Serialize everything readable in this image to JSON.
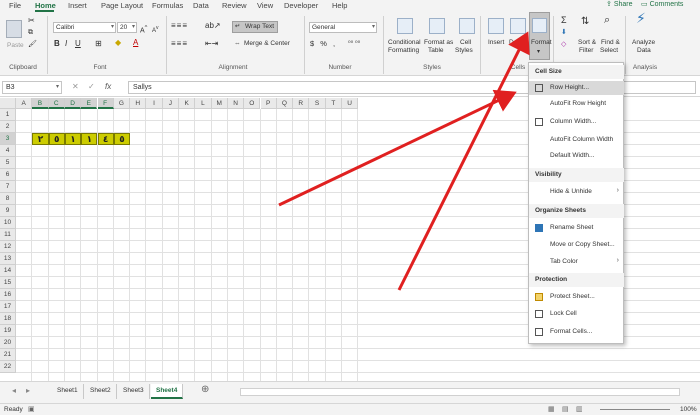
{
  "ribbon_tabs": [
    "File",
    "Home",
    "Insert",
    "Page Layout",
    "Formulas",
    "Data",
    "Review",
    "View",
    "Developer",
    "Help"
  ],
  "share_label": "Share",
  "comments_label": "Comments",
  "clipboard": {
    "paste": "Paste",
    "group": "Clipboard"
  },
  "font": {
    "name": "Calibri",
    "size": "20",
    "group": "Font"
  },
  "alignment": {
    "wrap": "Wrap Text",
    "merge": "Merge & Center",
    "group": "Alignment"
  },
  "number": {
    "format": "General",
    "group": "Number"
  },
  "styles": {
    "conditional": "Conditional",
    "formatting": "Formatting",
    "format_as": "Format as",
    "table": "Table",
    "cell": "Cell",
    "cell_styles": "Styles",
    "group": "Styles"
  },
  "cells": {
    "insert": "Insert",
    "delete": "Delete",
    "format": "Format",
    "group": "Cells"
  },
  "editing": {
    "sum": "Σ",
    "sort": "Sort &",
    "filter": "Filter",
    "find": "Find &",
    "select": "Select"
  },
  "analysis": {
    "analyze": "Analyze",
    "data": "Data",
    "group": "Analysis"
  },
  "formula_bar": {
    "namebox": "B3",
    "value": "Sallys"
  },
  "columns": [
    "A",
    "B",
    "C",
    "D",
    "E",
    "F",
    "G",
    "H",
    "I",
    "J",
    "K",
    "L",
    "M",
    "N",
    "O",
    "P",
    "Q",
    "R",
    "S",
    "T",
    "U"
  ],
  "rows": [
    "1",
    "2",
    "3",
    "4",
    "5",
    "6",
    "7",
    "8",
    "9",
    "10",
    "11",
    "12",
    "13",
    "14",
    "15",
    "16",
    "17",
    "18",
    "19",
    "20",
    "21",
    "22"
  ],
  "cell_values": [
    "٢",
    "٥",
    "١",
    "١",
    "٤",
    "٥"
  ],
  "menu": {
    "cell_size": "Cell Size",
    "row_height": "Row Height...",
    "autofit_row": "AutoFit Row Height",
    "column_width": "Column Width...",
    "autofit_col": "AutoFit Column Width",
    "default_width": "Default Width...",
    "visibility": "Visibility",
    "hide_unhide": "Hide & Unhide",
    "organize": "Organize Sheets",
    "rename": "Rename Sheet",
    "move_copy": "Move or Copy Sheet...",
    "tab_color": "Tab Color",
    "protection": "Protection",
    "protect": "Protect Sheet...",
    "lock": "Lock Cell",
    "format_cells": "Format Cells..."
  },
  "sheets": [
    "Sheet1",
    "Sheet2",
    "Sheet3",
    "Sheet4"
  ],
  "status": {
    "ready": "Ready",
    "zoom": "100%"
  },
  "colors": {
    "accent": "#217346",
    "cell_fill": "#cccc00",
    "arrow": "#e02020"
  }
}
